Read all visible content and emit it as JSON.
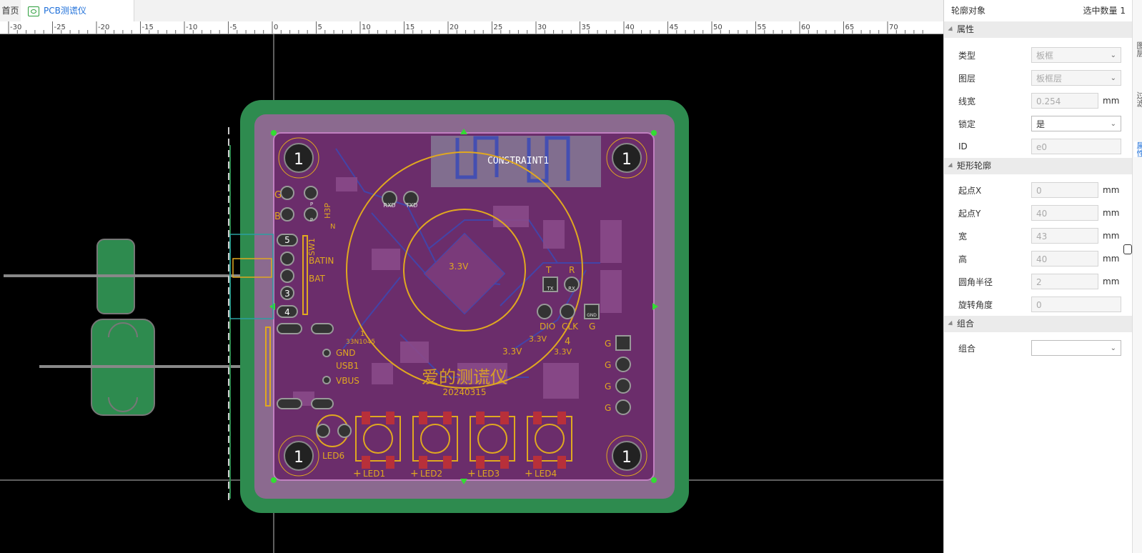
{
  "tabs": [
    {
      "label": "首页"
    },
    {
      "label": "PCB测谎仪"
    }
  ],
  "ruler": {
    "labels": [
      "-30",
      "-25",
      "-20",
      "-15",
      "-10",
      "-5",
      "0",
      "5",
      "10",
      "15",
      "20",
      "25",
      "30",
      "35",
      "40",
      "45",
      "50",
      "55",
      "60",
      "65",
      "70"
    ]
  },
  "board": {
    "constraint_label": "CONSTRAINT1",
    "title_text": "爱的测谎仪",
    "date_text": "20240315",
    "mount_hole_label": "1",
    "silk": {
      "g": "G",
      "b": "B",
      "h3p": "H3P",
      "n": "N",
      "sw1": "SW1",
      "batin": "BATIN",
      "bat": "BAT",
      "v33": "3.3V",
      "v33b": "3.3V",
      "v33c": "3.3V",
      "v33d": "3.3V",
      "t": "T",
      "r": "R",
      "dio": "DIO",
      "clk": "CLK",
      "gnd_g": "G",
      "gnd": "GND",
      "usb1": "USB1",
      "vbus": "VBUS",
      "ic": "1",
      "ic_name": "33N1045",
      "led6": "LED6",
      "led1": "LED1",
      "led2": "LED2",
      "led3": "LED3",
      "led4": "LED4",
      "four": "4",
      "g_right": "G",
      "p1": "P",
      "p2": "P",
      "rxd": "RXD",
      "txd": "TXD",
      "tx": "TX",
      "rx": "RX",
      "gnd_pad": "GND",
      "sw_pins": [
        "5",
        "",
        "",
        "3",
        "4"
      ]
    }
  },
  "panel": {
    "object_label": "轮廓对象",
    "selected_count": "选中数量 1",
    "sections": {
      "props": "属性",
      "rect": "矩形轮廓",
      "group": "组合"
    },
    "fields": {
      "type": {
        "label": "类型",
        "value": "板框"
      },
      "layer": {
        "label": "图层",
        "value": "板框层"
      },
      "width": {
        "label": "线宽",
        "value": "0.254",
        "unit": "mm"
      },
      "lock": {
        "label": "锁定",
        "value": "是"
      },
      "id": {
        "label": "ID",
        "value": "e0"
      },
      "start_x": {
        "label": "起点X",
        "value": "0",
        "unit": "mm"
      },
      "start_y": {
        "label": "起点Y",
        "value": "40",
        "unit": "mm"
      },
      "w": {
        "label": "宽",
        "value": "43",
        "unit": "mm"
      },
      "h": {
        "label": "高",
        "value": "40",
        "unit": "mm"
      },
      "radius": {
        "label": "圆角半径",
        "value": "2",
        "unit": "mm"
      },
      "rotation": {
        "label": "旋转角度",
        "value": "0"
      },
      "group": {
        "label": "组合",
        "value": ""
      }
    }
  },
  "side_strip": {
    "tab1": "图层",
    "tab2": "过滤",
    "tab3": "属性"
  },
  "colors": {
    "board_outer": "#2e8b4f",
    "board_mask": "#8b6a8f",
    "board_purple": "#6b2d6b",
    "silk": "#e0a820",
    "trace_blue": "#3a4ab8",
    "select_green": "#33dd33"
  }
}
